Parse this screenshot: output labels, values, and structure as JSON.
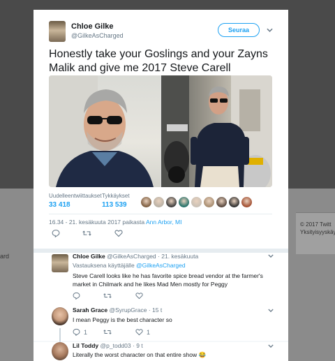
{
  "background": {
    "footer_lines": [
      "© 2017 Twitt",
      "Yksityisyyskäy"
    ],
    "left_text": "ard"
  },
  "tweet": {
    "author_name": "Chloe Gilke",
    "author_handle": "@GilkeAsCharged",
    "follow_label": "Seuraa",
    "text": "Honestly take your Goslings and your Zayns Malik and give me 2017 Steve Carell",
    "stats": {
      "retweets_label": "Uudelleentwiittaukset",
      "retweets_value": "33 418",
      "likes_label": "Tykkäykset",
      "likes_value": "113 539"
    },
    "liker_colors": [
      "#7b5a3c",
      "#b8b0a4",
      "#3a3a3a",
      "#1f6e66",
      "#c9c0b5",
      "#a68b6e",
      "#55443a",
      "#2a2a2a",
      "#a04a2c"
    ],
    "time": "16.34 - 21. kesäkuuta 2017 paikasta ",
    "location": "Ann Arbor, MI"
  },
  "replies": [
    {
      "name": "Chloe Gilke",
      "handle": "@GilkeAsCharged",
      "time": "· 21. kesäkuuta",
      "reply_to_prefix": "Vastauksena käyttäjälle ",
      "reply_to": "@GilkeAsCharged",
      "text": "Steve Carell looks like he has favorite spice bread vendor at the farmer's market in Chilmark and he likes Mad Men mostly for Peggy",
      "reply_count": "",
      "retweet_count": "",
      "like_count": ""
    },
    {
      "name": "Sarah Grace",
      "handle": "@SyrupGrace",
      "time": "· 15 t",
      "text": "I mean Peggy is the best character so",
      "reply_count": "1",
      "retweet_count": "",
      "like_count": "1"
    },
    {
      "name": "Lil Toddy",
      "handle": "@p_todd03",
      "time": "· 9 t",
      "text": "Literally the worst character on that entire show 😂"
    }
  ]
}
